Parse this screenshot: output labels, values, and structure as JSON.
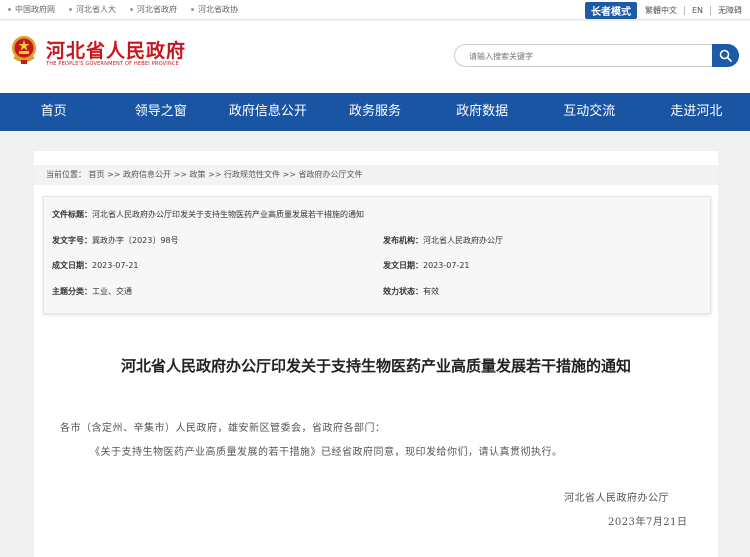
{
  "top_links": [
    "中国政府网",
    "河北省人大",
    "河北省政府",
    "河北省政协"
  ],
  "elder_mode": "长者模式",
  "lang_links": [
    "繁體中文",
    "EN",
    "无障碍"
  ],
  "brand": {
    "name_cn": "河北省人民政府",
    "name_en": "THE PEOPLE'S GOVERNMENT OF HEBEI PROVINCE"
  },
  "search": {
    "placeholder": "请输入搜索关键字"
  },
  "nav": [
    "首页",
    "领导之窗",
    "政府信息公开",
    "政务服务",
    "政府数据",
    "互动交流",
    "走进河北"
  ],
  "breadcrumb": "当前位置：  首页  >>  政府信息公开  >>  政策  >>  行政规范性文件  >>  省政府办公厅文件",
  "meta": {
    "title_label": "文件标题：",
    "title_value": "河北省人民政府办公厅印发关于支持生物医药产业高质量发展若干措施的通知",
    "doc_no_label": "发文字号：",
    "doc_no_value": "冀政办字〔2023〕98号",
    "issuer_label": "发布机构：",
    "issuer_value": "河北省人民政府办公厅",
    "written_label": "成文日期：",
    "written_value": "2023-07-21",
    "published_label": "发文日期：",
    "published_value": "2023-07-21",
    "topic_label": "主题分类：",
    "topic_value": "工业、交通",
    "status_label": "效力状态：",
    "status_value": "有效"
  },
  "document": {
    "heading": "河北省人民政府办公厅印发关于支持生物医药产业高质量发展若干措施的通知",
    "salutation": "各市（含定州、辛集市）人民政府，雄安新区管委会，省政府各部门：",
    "body": "《关于支持生物医药产业高质量发展的若干措施》已经省政府同意，现印发给你们，请认真贯彻执行。",
    "signature": "河北省人民政府办公厅",
    "date": "2023年7月21日"
  },
  "colors": {
    "brand_red": "#c8161d",
    "nav_blue": "#1a55a3"
  }
}
